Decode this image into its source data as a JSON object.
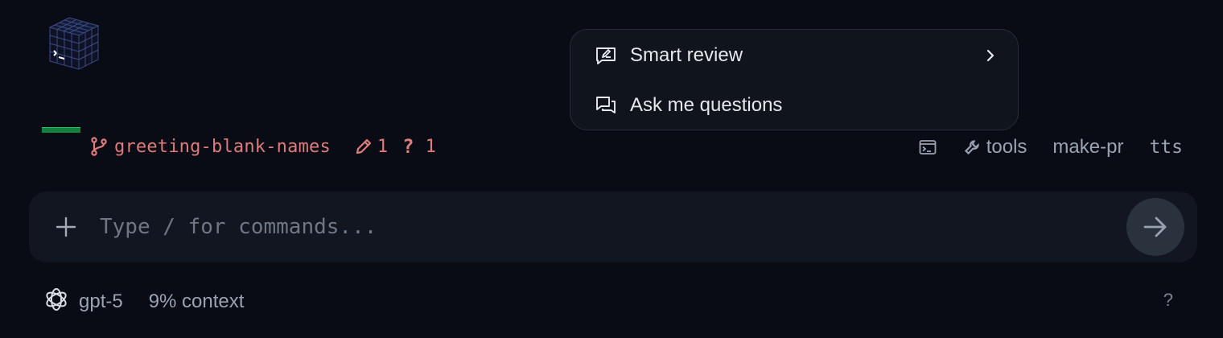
{
  "colors": {
    "background": "#090c14",
    "branch_accent": "#e07b7b",
    "progress_green": "#15803d",
    "popup_bg": "#0f141d",
    "input_bg": "#111621"
  },
  "branch": {
    "icon": "git-branch-icon",
    "name": "greeting-blank-names",
    "edits_icon": "pencil-icon",
    "edits_count": "1",
    "questions_glyph": "?",
    "questions_count": "1"
  },
  "toolbar": {
    "terminal_icon": "terminal-icon",
    "tools_icon": "wrench-icon",
    "tools_label": "tools",
    "make_pr_label": "make-pr",
    "tts_label": "tts"
  },
  "popup_menu": {
    "items": [
      {
        "icon": "review-edit-icon",
        "label": "Smart review",
        "has_submenu": true
      },
      {
        "icon": "chat-bubbles-icon",
        "label": "Ask me questions",
        "has_submenu": false
      }
    ]
  },
  "composer": {
    "add_icon": "plus-icon",
    "add_glyph": "+",
    "placeholder": "Type / for commands...",
    "value": "",
    "send_icon": "arrow-right-icon"
  },
  "footer": {
    "model_icon": "openai-logo-icon",
    "model": "gpt-5",
    "context": "9% context",
    "help": "?"
  }
}
